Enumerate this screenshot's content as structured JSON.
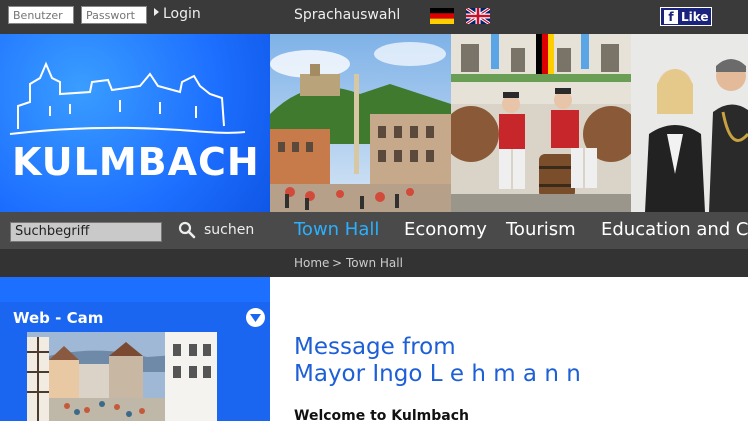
{
  "topbar": {
    "username_placeholder": "Benutzer",
    "password_placeholder": "Passwort",
    "login_label": "Login",
    "language_label": "Sprachauswahl",
    "facebook_like_label": "Like"
  },
  "header": {
    "logo_text": "KULMBACH"
  },
  "navbar": {
    "search_value": "Suchbegriff",
    "search_button": "suchen",
    "items": [
      {
        "label": "Town Hall",
        "active": true
      },
      {
        "label": "Economy",
        "active": false
      },
      {
        "label": "Tourism",
        "active": false
      },
      {
        "label": "Education and Cu",
        "active": false
      }
    ]
  },
  "breadcrumb": {
    "items": [
      "Home",
      "Town Hall"
    ],
    "separator": ">"
  },
  "sidebar": {
    "webcam_title": "Web - Cam"
  },
  "main": {
    "title_line1": "Message from",
    "title_line2": "Mayor Ingo L e h m a n n",
    "welcome": "Welcome to Kulmbach"
  },
  "colors": {
    "accent_blue": "#1d6fff",
    "nav_active": "#2ab0ff",
    "title_blue": "#1d5fd6"
  },
  "icons": {
    "search": "search-icon",
    "toggle": "chevron-down-icon",
    "flag_de": "german-flag-icon",
    "flag_uk": "uk-flag-icon"
  }
}
